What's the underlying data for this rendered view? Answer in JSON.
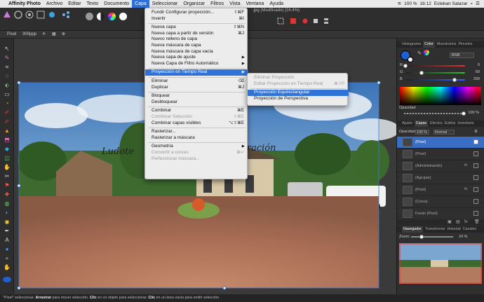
{
  "menubar": {
    "apple": "",
    "items": [
      "Affinity Photo",
      "Archivo",
      "Editar",
      "Texto",
      "Documento",
      "Capa",
      "Seleccionar",
      "Organizar",
      "Filtros",
      "Vista",
      "Ventana",
      "Ayuda"
    ],
    "active_index": 5,
    "status": {
      "battery": "100 %",
      "time": "16:12",
      "user": "Esteban Salazar"
    }
  },
  "document": {
    "title": ".jpg (Modificado) (24.4%)"
  },
  "context_bar": {
    "unit": "Píxel",
    "dpi": "300ppp"
  },
  "canvas": {
    "text_overlay_left": "Ludote",
    "text_overlay_right": "stración"
  },
  "capa_menu": {
    "items": [
      {
        "label": "Fundir Configurar proyección...",
        "shortcut": "⇧⌘F",
        "disabled": false
      },
      {
        "label": "Invertir",
        "shortcut": "⌘I",
        "disabled": false
      },
      {
        "sep": true
      },
      {
        "label": "Nueva capa",
        "shortcut": "⇧⌘N",
        "disabled": false
      },
      {
        "label": "Nueva capa a partir de versión",
        "shortcut": "⌘J",
        "disabled": false
      },
      {
        "label": "Nuevo relleno de capa",
        "shortcut": "",
        "disabled": false
      },
      {
        "label": "Nueva máscara de capa",
        "shortcut": "",
        "disabled": false
      },
      {
        "label": "Nueva máscara de capa vacía",
        "shortcut": "",
        "disabled": false
      },
      {
        "label": "Nueva capa de ajuste",
        "shortcut": "",
        "arrow": true,
        "disabled": false
      },
      {
        "label": "Nueva Capa de Filtro Automático",
        "shortcut": "",
        "arrow": true,
        "disabled": false
      },
      {
        "sep": true
      },
      {
        "label": "Proyección en Tiempo Real",
        "shortcut": "",
        "arrow": true,
        "disabled": false,
        "highlight": true
      },
      {
        "sep": true
      },
      {
        "label": "Eliminar",
        "shortcut": "⌫",
        "disabled": false
      },
      {
        "label": "Duplicar",
        "shortcut": "⌘J",
        "disabled": false
      },
      {
        "sep": true
      },
      {
        "label": "Bloquear",
        "shortcut": "",
        "disabled": false
      },
      {
        "label": "Desbloquear",
        "shortcut": "",
        "disabled": false
      },
      {
        "sep": true
      },
      {
        "label": "Combinar",
        "shortcut": "⌘E",
        "disabled": false
      },
      {
        "label": "Combinar Selección",
        "shortcut": "⇧⌘E",
        "disabled": true
      },
      {
        "label": "Combinar capas visibles",
        "shortcut": "⌥⇧⌘E",
        "disabled": false
      },
      {
        "sep": true
      },
      {
        "label": "Rasterizar...",
        "shortcut": "",
        "disabled": false
      },
      {
        "label": "Rasterizar a máscara",
        "shortcut": "",
        "disabled": false
      },
      {
        "sep": true
      },
      {
        "label": "Geometría",
        "shortcut": "",
        "arrow": true,
        "disabled": false
      },
      {
        "label": "Convertir a curvas",
        "shortcut": "⌘↩",
        "disabled": true
      },
      {
        "label": "Perfeccionar máscara...",
        "shortcut": "",
        "disabled": true
      }
    ]
  },
  "submenu": {
    "items": [
      {
        "label": "Eliminar Proyección",
        "shortcut": "",
        "disabled": true
      },
      {
        "label": "Editar Proyección en Tiempo Real",
        "shortcut": "⌘⇧P",
        "disabled": true
      },
      {
        "sep": true
      },
      {
        "label": "Proyección Equirectangular",
        "shortcut": "",
        "disabled": false,
        "highlight": true
      },
      {
        "label": "Proyección de Perspectiva",
        "shortcut": "",
        "disabled": false
      }
    ]
  },
  "color_panel": {
    "tabs": [
      "Histograma",
      "Color",
      "Muestrarios",
      "Pinceles"
    ],
    "active_tab": 1,
    "mode": "RGB",
    "sliders": [
      {
        "label": "R",
        "value": "0",
        "color": "#e03030",
        "level": 0.0
      },
      {
        "label": "G",
        "value": "69",
        "color": "#30c030",
        "level": 0.27
      },
      {
        "label": "B",
        "value": "209",
        "color": "#3060ff",
        "level": 0.82
      }
    ],
    "opacity_label": "Opacidad",
    "opacity_value": "100 %"
  },
  "layers_panel": {
    "tabs": [
      "Ajuste",
      "Capas",
      "Efectos",
      "Estilos",
      "Inventario"
    ],
    "active_tab": 1,
    "opacity_label": "Opacidad:",
    "opacity_value": "100 %",
    "blend_mode": "Normal",
    "layers": [
      {
        "name": "(Píxel)",
        "selected": true,
        "fx": false
      },
      {
        "name": "(Píxel)",
        "selected": false,
        "fx": false
      },
      {
        "name": "(Administración)",
        "selected": false,
        "fx": true
      },
      {
        "name": "(Agrupar)",
        "selected": false,
        "fx": false
      },
      {
        "name": "(Píxel)",
        "selected": false,
        "fx": true
      },
      {
        "name": "(Curva)",
        "selected": false,
        "fx": false
      },
      {
        "name": "Fondo (Píxel)",
        "selected": false,
        "fx": false
      }
    ]
  },
  "navigator_panel": {
    "tabs": [
      "Navegador",
      "Transformar",
      "Historial",
      "Canales"
    ],
    "active_tab": 0,
    "zoom_label": "Zoom:",
    "zoom_value": "24 %"
  },
  "status_bar": {
    "p1": "\"Píxel\" seleccionar.",
    "b1": "Arrastrar",
    "p2": "para mover selección.",
    "b2": "Clic",
    "p3": "en un objeto para seleccionar.",
    "b3": "Clic",
    "p4": "en un área vacía para omitir selección."
  }
}
